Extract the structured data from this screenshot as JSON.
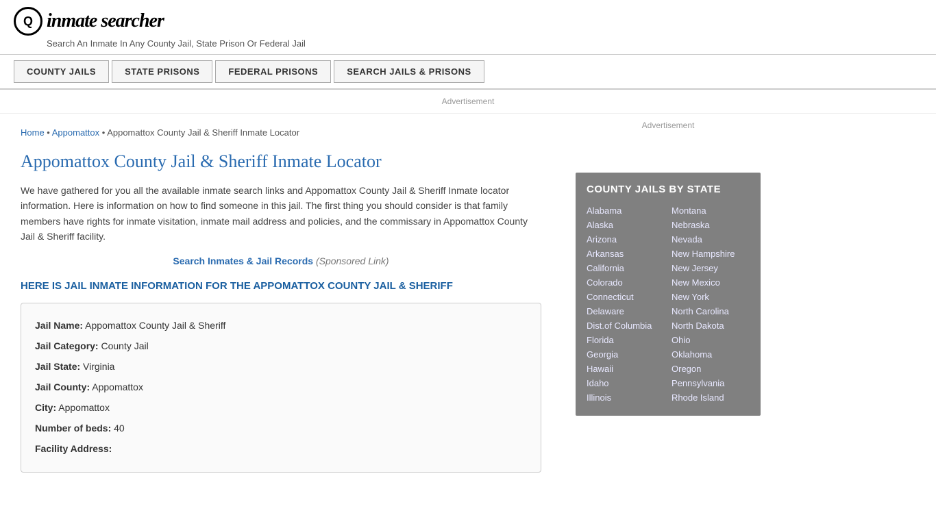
{
  "header": {
    "logo_icon": "Q",
    "logo_text": "inmate searcher",
    "tagline": "Search An Inmate In Any County Jail, State Prison Or Federal Jail"
  },
  "nav": {
    "buttons": [
      {
        "id": "county-jails",
        "label": "COUNTY JAILS"
      },
      {
        "id": "state-prisons",
        "label": "STATE PRISONS"
      },
      {
        "id": "federal-prisons",
        "label": "FEDERAL PRISONS"
      },
      {
        "id": "search-jails",
        "label": "SEARCH JAILS & PRISONS"
      }
    ]
  },
  "ad_label": "Advertisement",
  "breadcrumb": {
    "home": "Home",
    "separator1": " • ",
    "parent": "Appomattox",
    "separator2": " • ",
    "current": "Appomattox County Jail & Sheriff Inmate Locator"
  },
  "page_title": "Appomattox County Jail & Sheriff Inmate Locator",
  "description": "We have gathered for you all the available inmate search links and Appomattox County Jail & Sheriff Inmate locator information. Here is information on how to find someone in this jail. The first thing you should consider is that family members have rights for inmate visitation, inmate mail address and policies, and the commissary in Appomattox County Jail & Sheriff facility.",
  "search_link": {
    "text": "Search Inmates & Jail Records",
    "sponsored": "(Sponsored Link)"
  },
  "jail_info_heading": "HERE IS JAIL INMATE INFORMATION FOR THE APPOMATTOX COUNTY JAIL & SHERIFF",
  "jail_info": {
    "name_label": "Jail Name:",
    "name_value": "Appomattox County Jail & Sheriff",
    "category_label": "Jail Category:",
    "category_value": "County Jail",
    "state_label": "Jail State:",
    "state_value": "Virginia",
    "county_label": "Jail County:",
    "county_value": "Appomattox",
    "city_label": "City:",
    "city_value": "Appomattox",
    "beds_label": "Number of beds:",
    "beds_value": "40",
    "address_label": "Facility Address:"
  },
  "sidebar": {
    "ad_label": "Advertisement",
    "state_box_title": "COUNTY JAILS BY STATE",
    "states_left": [
      "Alabama",
      "Alaska",
      "Arizona",
      "Arkansas",
      "California",
      "Colorado",
      "Connecticut",
      "Delaware",
      "Dist.of Columbia",
      "Florida",
      "Georgia",
      "Hawaii",
      "Idaho",
      "Illinois"
    ],
    "states_right": [
      "Montana",
      "Nebraska",
      "Nevada",
      "New Hampshire",
      "New Jersey",
      "New Mexico",
      "New York",
      "North Carolina",
      "North Dakota",
      "Ohio",
      "Oklahoma",
      "Oregon",
      "Pennsylvania",
      "Rhode Island"
    ]
  }
}
